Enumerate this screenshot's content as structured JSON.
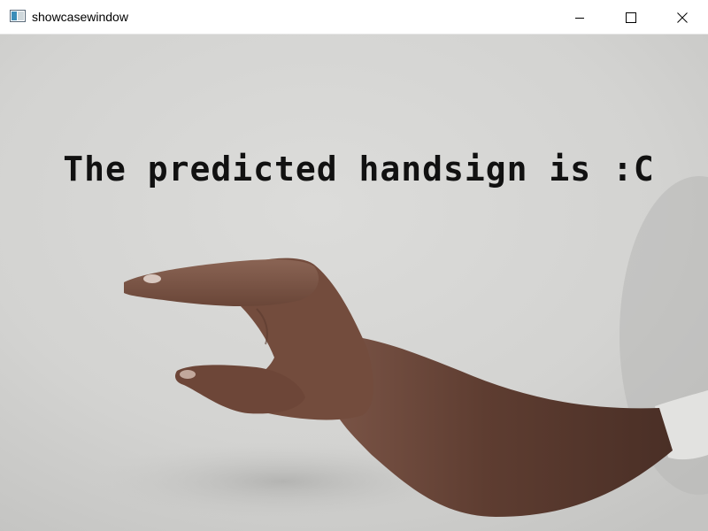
{
  "window": {
    "title": "showcasewindow",
    "controls": {
      "minimize_icon": "minimize-icon",
      "maximize_icon": "maximize-icon",
      "close_icon": "close-icon"
    }
  },
  "feed": {
    "prediction_text": "The predicted handsign is :C",
    "background_color": "#d4d4d2",
    "skin_color": "#6e4a3c"
  }
}
